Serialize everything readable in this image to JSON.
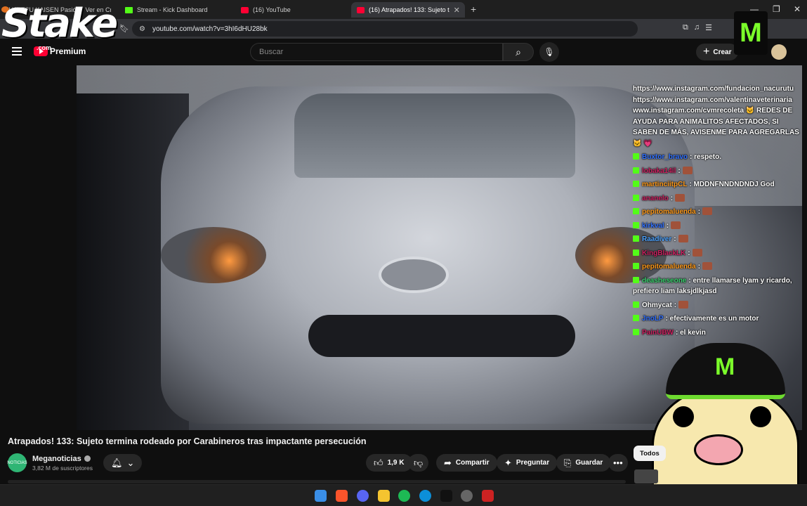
{
  "browser": {
    "tabs": [
      {
        "label": "JUJUTSU KAISEN Pasión - Ver en Cru",
        "active": false
      },
      {
        "label": "Stream - Kick Dashboard",
        "active": false
      },
      {
        "label": "(16) YouTube",
        "active": false
      },
      {
        "label": "(16) Atrapados! 133: Sujeto t",
        "active": true
      }
    ],
    "url": "youtube.com/watch?v=3hI6dHU28bk"
  },
  "youtube": {
    "logo_text": "Premium",
    "search_placeholder": "Buscar",
    "create_label": "Crear",
    "video_title": "Atrapados! 133: Sujeto termina rodeado por Carabineros tras impactante persecución",
    "channel": {
      "name": "Meganoticias",
      "subscribers": "3,82 M de suscriptores",
      "avatar_text": "NOTICIAS"
    },
    "actions": {
      "likes": "1,9 K",
      "share": "Compartir",
      "ask": "Preguntar",
      "save": "Guardar"
    },
    "filter_chip": "Todos"
  },
  "overlay": {
    "stake_logo": "Stake",
    "stake_com": ".com",
    "chat": [
      {
        "text": "https://www.instagram.com/fundacion_nacurutu https://www.instagram.com/valentinaveterinaria www.instagram.com/cvmrecoleta 🐱 REDES DE AYUDA PARA ANIMALITOS AFECTADOS, SI SABEN DE MÁS, AVISENME PARA AGREGARLAS 🐱 💗"
      },
      {
        "user": "Buxtor_bravo",
        "color": "#2f6fff",
        "message": ": respeto."
      },
      {
        "user": "lobaka14il",
        "color": "#cc2060",
        "message": ":",
        "emote": true
      },
      {
        "user": "martinciitpCL",
        "color": "#ff9a1a",
        "message": ": MDDNFNNDNDNDJ God"
      },
      {
        "user": "ananelo",
        "color": "#cc2060",
        "message": ":",
        "emote": true
      },
      {
        "user": "pepitomaluenda",
        "color": "#ff9a1a",
        "message": ":",
        "emote": true
      },
      {
        "user": "kirkval",
        "color": "#3070ff",
        "message": ":",
        "emote": true
      },
      {
        "user": "Raadiver",
        "color": "#4da3ff",
        "message": ":",
        "emote": true
      },
      {
        "user": "KingBlackLK",
        "color": "#cc2060",
        "message": ":",
        "emote": true
      },
      {
        "user": "pepitomaluenda",
        "color": "#ff9a1a",
        "message": ":",
        "emote": true
      },
      {
        "user": "deasheseone",
        "color": "#3bd16f",
        "message": ": entre llamarse lyam y ricardo, prefiero liam laksjdlkjasd"
      },
      {
        "user": "Ohmycat",
        "color": "#ffffff",
        "message": ":",
        "emote": true
      },
      {
        "user": "JnoLP",
        "color": "#2f6fff",
        "message": ": efectivamente es un motor"
      },
      {
        "user": "PainUBW",
        "color": "#cc2060",
        "message": ": el kevin"
      }
    ]
  },
  "colors": {
    "youtube_red": "#ff0033",
    "kick_green": "#53fc18",
    "background": "#0f0f0f"
  }
}
